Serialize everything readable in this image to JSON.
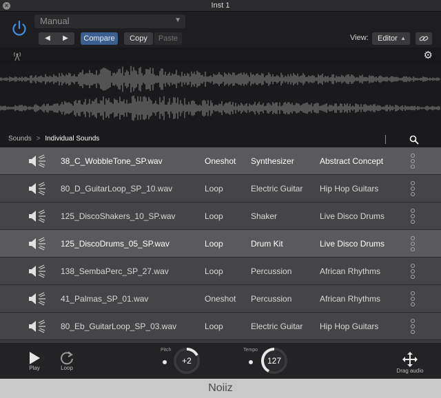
{
  "window": {
    "title": "Inst 1"
  },
  "header": {
    "preset": "Manual",
    "compare_label": "Compare",
    "copy_label": "Copy",
    "paste_label": "Paste",
    "view_label": "View:",
    "view_value": "Editor"
  },
  "breadcrumb": {
    "root": "Sounds",
    "separator": ">",
    "current": "Individual Sounds"
  },
  "sounds": [
    {
      "name": "38_C_WobbleTone_SP.wav",
      "type": "Oneshot",
      "instrument": "Synthesizer",
      "genre": "Abstract Concept",
      "selected": true
    },
    {
      "name": "80_D_GuitarLoop_SP_10.wav",
      "type": "Loop",
      "instrument": "Electric Guitar",
      "genre": "Hip Hop Guitars",
      "selected": false
    },
    {
      "name": "125_DiscoShakers_10_SP.wav",
      "type": "Loop",
      "instrument": "Shaker",
      "genre": "Live Disco Drums",
      "selected": false
    },
    {
      "name": "125_DiscoDrums_05_SP.wav",
      "type": "Loop",
      "instrument": "Drum Kit",
      "genre": "Live Disco Drums",
      "selected": true
    },
    {
      "name": "138_SembaPerc_SP_27.wav",
      "type": "Loop",
      "instrument": "Percussion",
      "genre": "African Rhythms",
      "selected": false
    },
    {
      "name": "41_Palmas_SP_01.wav",
      "type": "Oneshot",
      "instrument": "Percussion",
      "genre": "African Rhythms",
      "selected": false
    },
    {
      "name": "80_Eb_GuitarLoop_SP_03.wav",
      "type": "Loop",
      "instrument": "Electric Guitar",
      "genre": "Hip Hop Guitars",
      "selected": false
    }
  ],
  "transport": {
    "play_label": "Play",
    "loop_label": "Loop",
    "pitch_label": "Pitch",
    "pitch_value": "+2",
    "tempo_label": "Tempo",
    "tempo_value": "127",
    "drag_label": "Drag audio"
  },
  "footer": {
    "brand": "Noiiz"
  },
  "colors": {
    "accent": "#3b5f8f",
    "power": "#3f8fe0",
    "selected_row": "#5a5a5c"
  },
  "icons": [
    "close-icon",
    "power-icon",
    "prev-icon",
    "next-icon",
    "link-icon",
    "antenna-icon",
    "gear-icon",
    "search-icon",
    "speaker-icon",
    "more-icon",
    "play-icon",
    "loop-icon",
    "move-icon"
  ]
}
